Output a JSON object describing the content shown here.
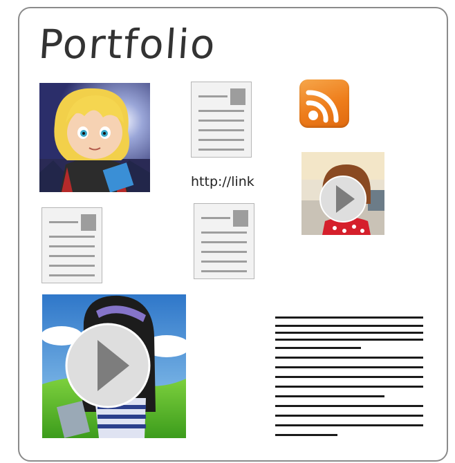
{
  "page": {
    "title": "Portfolio"
  },
  "items": {
    "link_text": "http://link"
  },
  "icons": {
    "rss": "rss-feed-icon",
    "play": "play-icon",
    "document": "document-icon"
  },
  "colors": {
    "rss_orange": "#ee7d1b",
    "frame_border": "#8a8a8a",
    "doc_gray": "#9d9d9d"
  }
}
